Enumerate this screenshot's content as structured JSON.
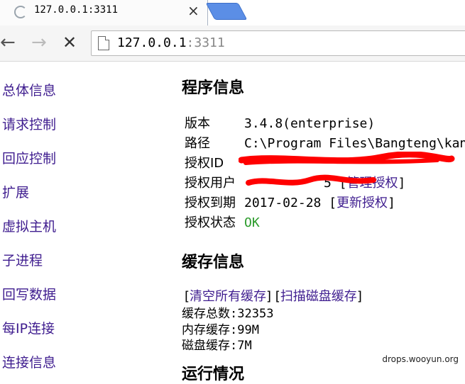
{
  "tab": {
    "title": "127.0.0.1:3311",
    "close_glyph": "×"
  },
  "toolbar": {
    "back_glyph": "←",
    "forward_glyph": "→",
    "stop_glyph": "✕",
    "url_host": "127.0.0.1",
    "url_port": ":3311"
  },
  "sidebar": {
    "items": [
      {
        "label": "总体信息"
      },
      {
        "label": "请求控制"
      },
      {
        "label": "回应控制"
      },
      {
        "label": "扩展"
      },
      {
        "label": "虚拟主机"
      },
      {
        "label": "子进程"
      },
      {
        "label": "回写数据"
      },
      {
        "label": "每IP连接"
      },
      {
        "label": "连接信息"
      }
    ]
  },
  "program": {
    "heading": "程序信息",
    "version_label": "版本",
    "version_value": "3.4.8(enterprise)",
    "path_label": "路径",
    "path_value": "C:\\Program Files\\Bangteng\\kang",
    "license_id_label": "授权ID",
    "license_user_label": "授权用户",
    "license_user_suffix": "5 [",
    "manage_link": "管理授权",
    "expire_label": "授权到期",
    "expire_value": "2017-02-28",
    "renew_link": "更新授权",
    "status_label": "授权状态",
    "status_value": "OK"
  },
  "cache": {
    "heading": "缓存信息",
    "clear_link": "清空所有缓存",
    "scan_link": "扫描磁盘缓存",
    "total_label": "缓存总数:",
    "total_value": "32353",
    "memory_label": "内存缓存:",
    "memory_value": "99M",
    "disk_label": "磁盘缓存:",
    "disk_value": "7M"
  },
  "next_heading": "运行情况",
  "watermark": "drops.wooyun.org",
  "colors": {
    "link": "#3f1d8f",
    "ok": "#2b9b2b",
    "redaction": "#ff0000",
    "new_tab": "#5b8ee6"
  },
  "icons": [
    "loading-spinner-icon",
    "close-icon",
    "back-arrow-icon",
    "forward-arrow-icon",
    "stop-icon",
    "page-icon"
  ]
}
